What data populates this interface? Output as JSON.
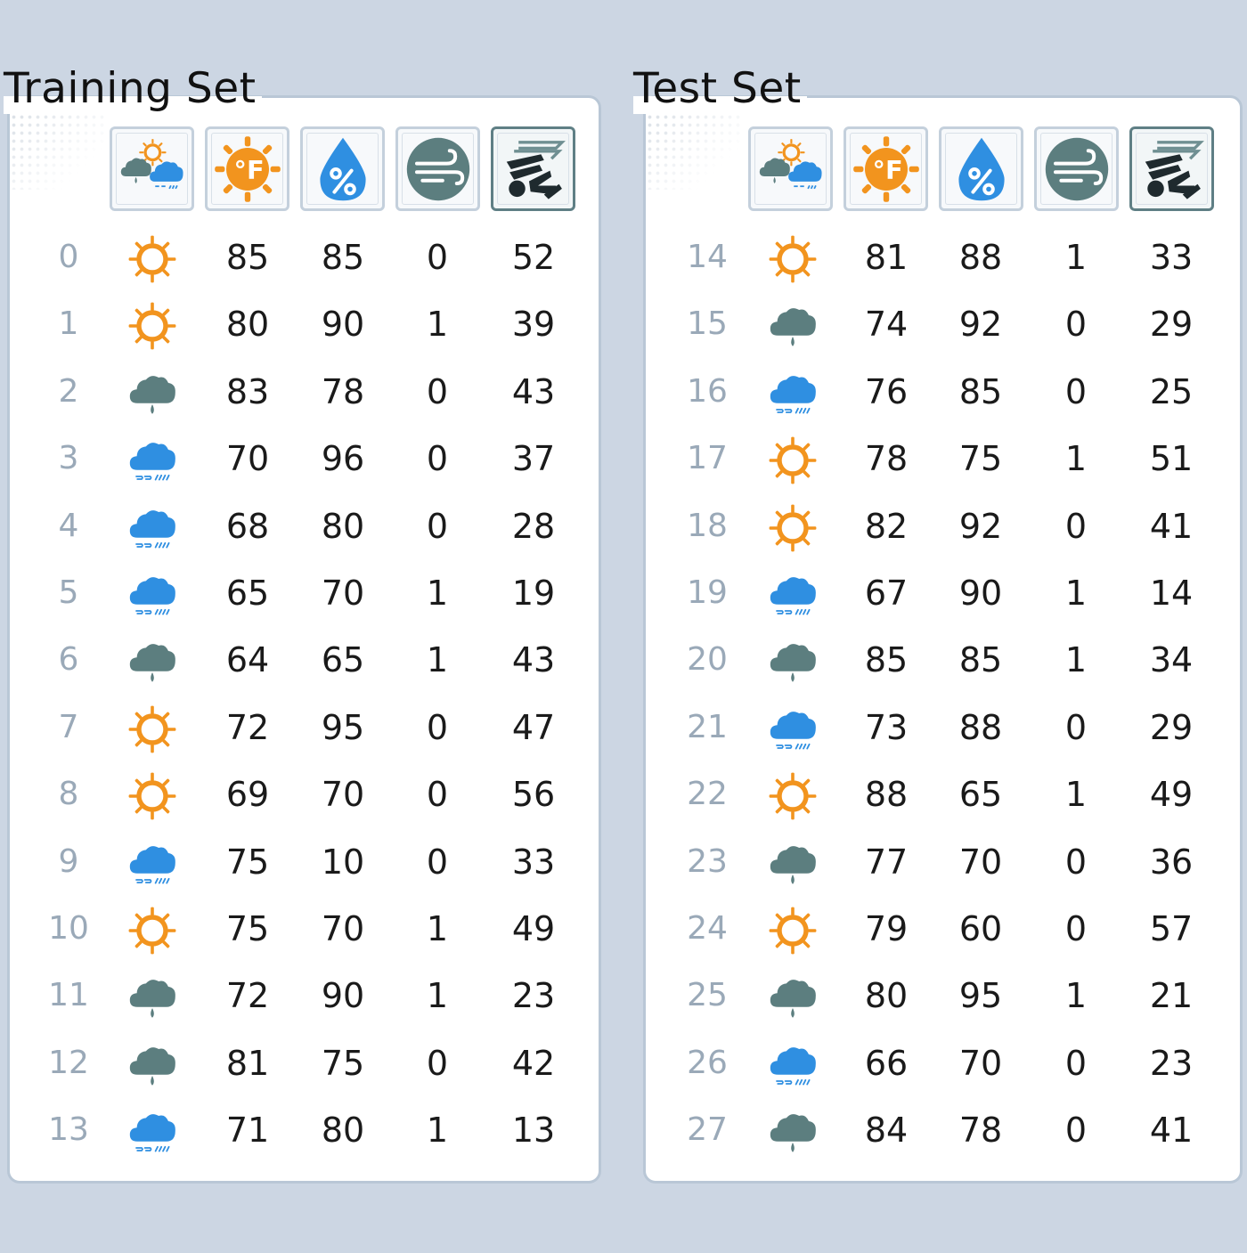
{
  "colors": {
    "sun": "#f2941e",
    "cloud_gray": "#5c7e7f",
    "cloud_blue": "#2f8fe1",
    "index_text": "#9aa9b8"
  },
  "columns": [
    {
      "key": "outlook",
      "icon": "outlook-icon"
    },
    {
      "key": "temperature",
      "icon": "temperature-icon"
    },
    {
      "key": "humidity",
      "icon": "humidity-icon"
    },
    {
      "key": "wind",
      "icon": "wind-icon"
    },
    {
      "key": "target",
      "icon": "target-icon"
    }
  ],
  "training_set": {
    "title": "Training Set",
    "rows": [
      {
        "index": "0",
        "outlook": "sunny",
        "temperature": "85",
        "humidity": "85",
        "wind": "0",
        "target": "52"
      },
      {
        "index": "1",
        "outlook": "sunny",
        "temperature": "80",
        "humidity": "90",
        "wind": "1",
        "target": "39"
      },
      {
        "index": "2",
        "outlook": "overcast",
        "temperature": "83",
        "humidity": "78",
        "wind": "0",
        "target": "43"
      },
      {
        "index": "3",
        "outlook": "rainy",
        "temperature": "70",
        "humidity": "96",
        "wind": "0",
        "target": "37"
      },
      {
        "index": "4",
        "outlook": "rainy",
        "temperature": "68",
        "humidity": "80",
        "wind": "0",
        "target": "28"
      },
      {
        "index": "5",
        "outlook": "rainy",
        "temperature": "65",
        "humidity": "70",
        "wind": "1",
        "target": "19"
      },
      {
        "index": "6",
        "outlook": "overcast",
        "temperature": "64",
        "humidity": "65",
        "wind": "1",
        "target": "43"
      },
      {
        "index": "7",
        "outlook": "sunny",
        "temperature": "72",
        "humidity": "95",
        "wind": "0",
        "target": "47"
      },
      {
        "index": "8",
        "outlook": "sunny",
        "temperature": "69",
        "humidity": "70",
        "wind": "0",
        "target": "56"
      },
      {
        "index": "9",
        "outlook": "rainy",
        "temperature": "75",
        "humidity": "10",
        "wind": "0",
        "target": "33"
      },
      {
        "index": "10",
        "outlook": "sunny",
        "temperature": "75",
        "humidity": "70",
        "wind": "1",
        "target": "49"
      },
      {
        "index": "11",
        "outlook": "overcast",
        "temperature": "72",
        "humidity": "90",
        "wind": "1",
        "target": "23"
      },
      {
        "index": "12",
        "outlook": "overcast",
        "temperature": "81",
        "humidity": "75",
        "wind": "0",
        "target": "42"
      },
      {
        "index": "13",
        "outlook": "rainy",
        "temperature": "71",
        "humidity": "80",
        "wind": "1",
        "target": "13"
      }
    ]
  },
  "test_set": {
    "title": "Test Set",
    "rows": [
      {
        "index": "14",
        "outlook": "sunny",
        "temperature": "81",
        "humidity": "88",
        "wind": "1",
        "target": "33"
      },
      {
        "index": "15",
        "outlook": "overcast",
        "temperature": "74",
        "humidity": "92",
        "wind": "0",
        "target": "29"
      },
      {
        "index": "16",
        "outlook": "rainy",
        "temperature": "76",
        "humidity": "85",
        "wind": "0",
        "target": "25"
      },
      {
        "index": "17",
        "outlook": "sunny",
        "temperature": "78",
        "humidity": "75",
        "wind": "1",
        "target": "51"
      },
      {
        "index": "18",
        "outlook": "sunny",
        "temperature": "82",
        "humidity": "92",
        "wind": "0",
        "target": "41"
      },
      {
        "index": "19",
        "outlook": "rainy",
        "temperature": "67",
        "humidity": "90",
        "wind": "1",
        "target": "14"
      },
      {
        "index": "20",
        "outlook": "overcast",
        "temperature": "85",
        "humidity": "85",
        "wind": "1",
        "target": "34"
      },
      {
        "index": "21",
        "outlook": "rainy",
        "temperature": "73",
        "humidity": "88",
        "wind": "0",
        "target": "29"
      },
      {
        "index": "22",
        "outlook": "sunny",
        "temperature": "88",
        "humidity": "65",
        "wind": "1",
        "target": "49"
      },
      {
        "index": "23",
        "outlook": "overcast",
        "temperature": "77",
        "humidity": "70",
        "wind": "0",
        "target": "36"
      },
      {
        "index": "24",
        "outlook": "sunny",
        "temperature": "79",
        "humidity": "60",
        "wind": "0",
        "target": "57"
      },
      {
        "index": "25",
        "outlook": "overcast",
        "temperature": "80",
        "humidity": "95",
        "wind": "1",
        "target": "21"
      },
      {
        "index": "26",
        "outlook": "rainy",
        "temperature": "66",
        "humidity": "70",
        "wind": "0",
        "target": "23"
      },
      {
        "index": "27",
        "outlook": "overcast",
        "temperature": "84",
        "humidity": "78",
        "wind": "0",
        "target": "41"
      }
    ]
  }
}
